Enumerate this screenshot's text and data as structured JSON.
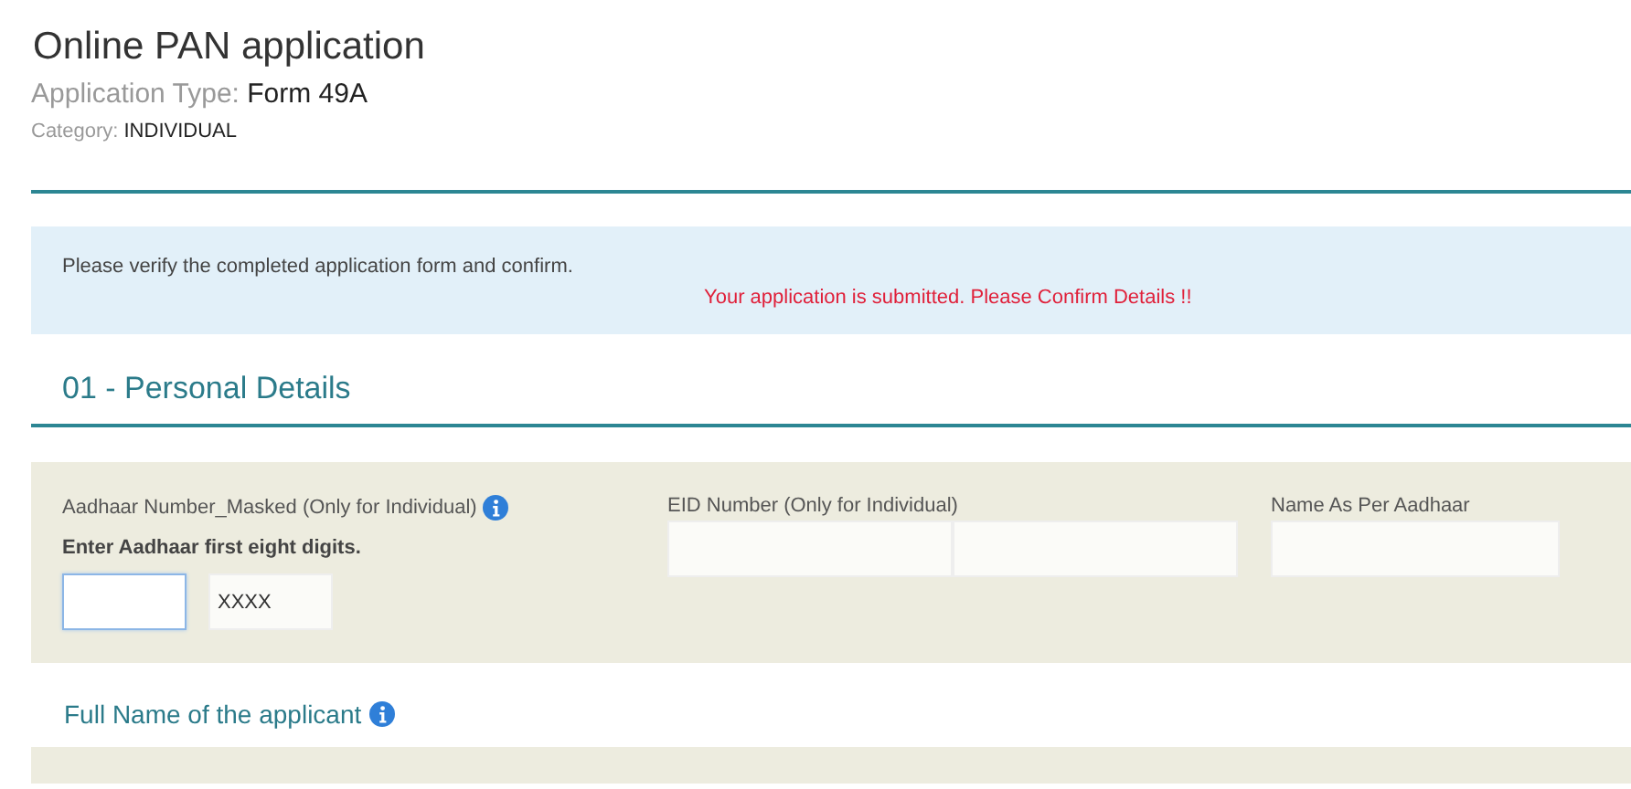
{
  "header": {
    "title": "Online PAN application",
    "application_type_label": "Application Type:",
    "application_type": "Form 49A",
    "category_label": "Category:",
    "category": "INDIVIDUAL"
  },
  "notice": {
    "message": "Please verify the completed application form and confirm.",
    "alert": "Your application is submitted. Please Confirm Details !!"
  },
  "section": {
    "title": "01 - Personal Details"
  },
  "fields": [
    {
      "label": "Aadhaar Number_Masked (Only for Individual)",
      "info": true,
      "hint": "Enter Aadhaar first eight digits.",
      "inputs": [
        {
          "focused": true
        },
        {
          "value": "XXXX",
          "focused": false
        }
      ]
    },
    {
      "label": "EID Number (Only for Individual)",
      "info": false,
      "inputs": [
        {
          "focused": false
        },
        {
          "focused": false
        }
      ]
    },
    {
      "label": "Name As Per Aadhaar",
      "info": false,
      "inputs": [
        {
          "focused": false
        }
      ]
    }
  ],
  "next_section": {
    "title": "Full Name of the applicant",
    "info": true
  }
}
